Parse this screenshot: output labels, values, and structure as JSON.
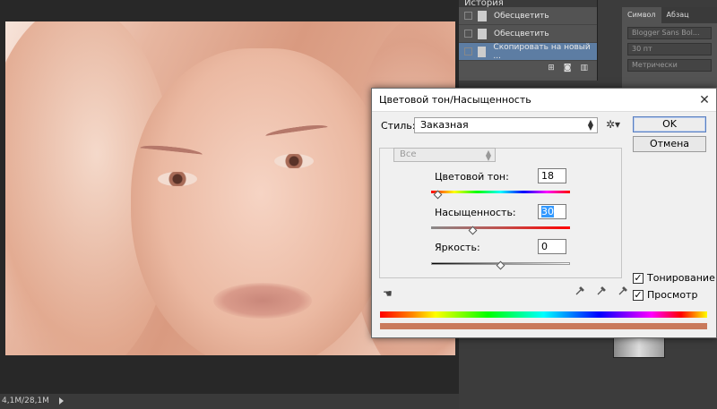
{
  "background": {
    "status_size": "4,1M/28,1M",
    "history": {
      "header": "История",
      "items": [
        {
          "label": "Обесцветить",
          "selected": false
        },
        {
          "label": "Обесцветить",
          "selected": false
        },
        {
          "label": "Скопировать на новый ...",
          "selected": true
        }
      ]
    },
    "character_panel": {
      "tabs": [
        "Символ",
        "Абзац"
      ],
      "font": "Blogger Sans Bol...",
      "size": "30 пт",
      "kerning": "Метрически"
    }
  },
  "dialog": {
    "title": "Цветовой тон/Насыщенность",
    "close_icon": "close-icon",
    "style_label": "Стиль:",
    "style_value": "Заказная",
    "ok_label": "OK",
    "cancel_label": "Отмена",
    "channel_value": "Все",
    "hue": {
      "label": "Цветовой тон:",
      "value": "18",
      "position": 0.05
    },
    "saturation": {
      "label": "Насыщенность:",
      "value": "30",
      "position": 0.3
    },
    "lightness": {
      "label": "Яркость:",
      "value": "0",
      "position": 0.5
    },
    "colorize": {
      "label": "Тонирование",
      "checked": true
    },
    "preview": {
      "label": "Просмотр",
      "checked": true
    },
    "colors": {
      "result_bar": "#c97a5c",
      "ok_border": "#5a7fbf"
    }
  }
}
